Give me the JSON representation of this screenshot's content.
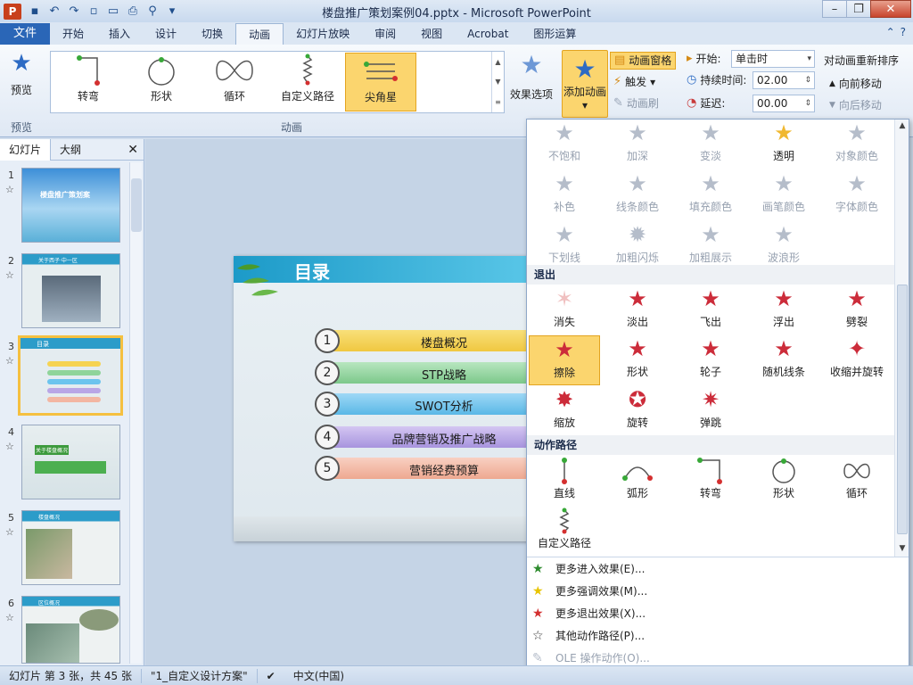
{
  "window": {
    "title": "楼盘推广策划案例04.pptx - Microsoft PowerPoint",
    "app_logo": "P"
  },
  "qat": [
    "save-icon",
    "undo-icon",
    "redo-icon",
    "new-icon",
    "open-icon",
    "print-icon",
    "preview-icon",
    "customize-icon"
  ],
  "tabs": {
    "file": "文件",
    "items": [
      "开始",
      "插入",
      "设计",
      "切换",
      "动画",
      "幻灯片放映",
      "审阅",
      "视图",
      "Acrobat",
      "图形运算"
    ],
    "active": "动画"
  },
  "ribbon": {
    "preview_label": "预览",
    "preview_group": "预览",
    "animation_group": "动画",
    "gallery": [
      {
        "label": "转弯",
        "icon": "turn-path-icon"
      },
      {
        "label": "形状",
        "icon": "shape-path-icon"
      },
      {
        "label": "循环",
        "icon": "loop-path-icon"
      },
      {
        "label": "自定义路径",
        "icon": "custom-path-icon"
      },
      {
        "label": "尖角星",
        "icon": "star-path-icon",
        "selected": true
      }
    ],
    "effect_options": "效果选项",
    "add_animation": "添加动画",
    "anim_pane": "动画窗格",
    "trigger": "触发",
    "anim_painter": "动画刷",
    "start_label": "开始:",
    "start_value": "单击时",
    "duration_label": "持续时间:",
    "duration_value": "02.00",
    "delay_label": "延迟:",
    "delay_value": "00.00",
    "reorder_title": "对动画重新排序",
    "move_earlier": "向前移动",
    "move_later": "向后移动"
  },
  "left_panel": {
    "tab_slides": "幻灯片",
    "tab_outline": "大纲",
    "thumbs": [
      {
        "num": "1",
        "title": "楼盘推广策划案"
      },
      {
        "num": "2",
        "title": "关于西子·中一区"
      },
      {
        "num": "3",
        "title": "目录"
      },
      {
        "num": "4",
        "title": "关于楼盘概况"
      },
      {
        "num": "5",
        "title": "楼盘概况"
      },
      {
        "num": "6",
        "title": "区位概况"
      }
    ],
    "selected_index": 2
  },
  "slide": {
    "title": "目录",
    "items": [
      {
        "num": "1",
        "text": "楼盘概况",
        "color": "#f6d352"
      },
      {
        "num": "2",
        "text": "STP战略",
        "color": "#8fd49a"
      },
      {
        "num": "3",
        "text": "SWOT分析",
        "color": "#6cc4ee"
      },
      {
        "num": "4",
        "text": "品牌营销及推广战略",
        "color": "#b9a6e6"
      },
      {
        "num": "5",
        "text": "营销经费预算",
        "color": "#f3b6a2"
      }
    ]
  },
  "dropdown": {
    "emphasis_row1": [
      "不饱和",
      "加深",
      "变淡",
      "透明",
      "对象颜色"
    ],
    "emphasis_row2": [
      "补色",
      "线条颜色",
      "填充颜色",
      "画笔颜色",
      "字体颜色"
    ],
    "emphasis_row3": [
      "下划线",
      "加粗闪烁",
      "加粗展示",
      "波浪形"
    ],
    "exit_header": "退出",
    "exit_row1": [
      "消失",
      "淡出",
      "飞出",
      "浮出",
      "劈裂"
    ],
    "exit_row2": [
      "擦除",
      "形状",
      "轮子",
      "随机线条",
      "收缩并旋转"
    ],
    "exit_row3": [
      "缩放",
      "旋转",
      "弹跳"
    ],
    "path_header": "动作路径",
    "path_row1": [
      "直线",
      "弧形",
      "转弯",
      "形状",
      "循环"
    ],
    "path_row2": [
      "自定义路径"
    ],
    "more": [
      {
        "label": "更多进入效果(E)...",
        "icon": "green-star-icon",
        "color": "#2e8b2e"
      },
      {
        "label": "更多强调效果(M)...",
        "icon": "yellow-star-icon",
        "color": "#e8c400"
      },
      {
        "label": "更多退出效果(X)...",
        "icon": "red-star-icon",
        "color": "#d43030"
      },
      {
        "label": "其他动作路径(P)...",
        "icon": "outline-star-icon",
        "color": "#333333"
      },
      {
        "label": "OLE 操作动作(O)...",
        "icon": "ole-icon",
        "color": "#97a1b0",
        "disabled": true
      }
    ]
  },
  "status": {
    "slide_info": "幻灯片 第 3 张，共 45 张",
    "theme": "\"1_自定义设计方案\"",
    "language": "中文(中国)"
  }
}
